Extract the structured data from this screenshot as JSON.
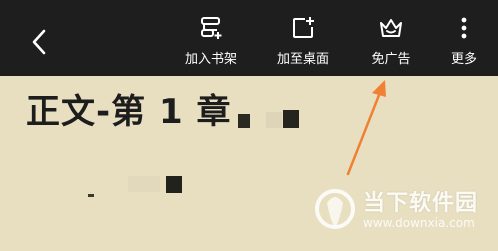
{
  "toolbar": {
    "back_icon": "chevron-left-icon",
    "actions": [
      {
        "label": "加入书架",
        "icon": "add-shelf-icon"
      },
      {
        "label": "加至桌面",
        "icon": "add-desktop-icon"
      },
      {
        "label": "免广告",
        "icon": "crown-icon"
      },
      {
        "label": "更多",
        "icon": "more-vertical-icon"
      }
    ]
  },
  "reader": {
    "chapter_title": "正文-第 1 章"
  },
  "annotation": {
    "arrow_color": "#f08034"
  },
  "watermark": {
    "name": "当下软件园",
    "url": "www.downxia.com"
  },
  "colors": {
    "toolbar_bg": "#1e1e1e",
    "page_bg": "#e8dfc1",
    "text": "#1d1d1d"
  }
}
